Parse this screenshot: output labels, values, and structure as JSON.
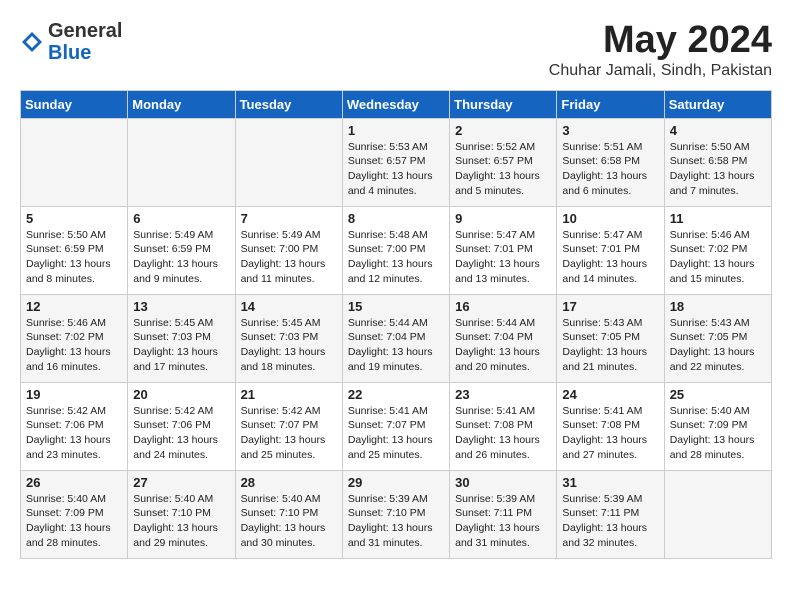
{
  "logo": {
    "general": "General",
    "blue": "Blue"
  },
  "title": {
    "month_year": "May 2024",
    "location": "Chuhar Jamali, Sindh, Pakistan"
  },
  "headers": [
    "Sunday",
    "Monday",
    "Tuesday",
    "Wednesday",
    "Thursday",
    "Friday",
    "Saturday"
  ],
  "weeks": [
    [
      {
        "day": "",
        "lines": []
      },
      {
        "day": "",
        "lines": []
      },
      {
        "day": "",
        "lines": []
      },
      {
        "day": "1",
        "lines": [
          "Sunrise: 5:53 AM",
          "Sunset: 6:57 PM",
          "Daylight: 13 hours",
          "and 4 minutes."
        ]
      },
      {
        "day": "2",
        "lines": [
          "Sunrise: 5:52 AM",
          "Sunset: 6:57 PM",
          "Daylight: 13 hours",
          "and 5 minutes."
        ]
      },
      {
        "day": "3",
        "lines": [
          "Sunrise: 5:51 AM",
          "Sunset: 6:58 PM",
          "Daylight: 13 hours",
          "and 6 minutes."
        ]
      },
      {
        "day": "4",
        "lines": [
          "Sunrise: 5:50 AM",
          "Sunset: 6:58 PM",
          "Daylight: 13 hours",
          "and 7 minutes."
        ]
      }
    ],
    [
      {
        "day": "5",
        "lines": [
          "Sunrise: 5:50 AM",
          "Sunset: 6:59 PM",
          "Daylight: 13 hours",
          "and 8 minutes."
        ]
      },
      {
        "day": "6",
        "lines": [
          "Sunrise: 5:49 AM",
          "Sunset: 6:59 PM",
          "Daylight: 13 hours",
          "and 9 minutes."
        ]
      },
      {
        "day": "7",
        "lines": [
          "Sunrise: 5:49 AM",
          "Sunset: 7:00 PM",
          "Daylight: 13 hours",
          "and 11 minutes."
        ]
      },
      {
        "day": "8",
        "lines": [
          "Sunrise: 5:48 AM",
          "Sunset: 7:00 PM",
          "Daylight: 13 hours",
          "and 12 minutes."
        ]
      },
      {
        "day": "9",
        "lines": [
          "Sunrise: 5:47 AM",
          "Sunset: 7:01 PM",
          "Daylight: 13 hours",
          "and 13 minutes."
        ]
      },
      {
        "day": "10",
        "lines": [
          "Sunrise: 5:47 AM",
          "Sunset: 7:01 PM",
          "Daylight: 13 hours",
          "and 14 minutes."
        ]
      },
      {
        "day": "11",
        "lines": [
          "Sunrise: 5:46 AM",
          "Sunset: 7:02 PM",
          "Daylight: 13 hours",
          "and 15 minutes."
        ]
      }
    ],
    [
      {
        "day": "12",
        "lines": [
          "Sunrise: 5:46 AM",
          "Sunset: 7:02 PM",
          "Daylight: 13 hours",
          "and 16 minutes."
        ]
      },
      {
        "day": "13",
        "lines": [
          "Sunrise: 5:45 AM",
          "Sunset: 7:03 PM",
          "Daylight: 13 hours",
          "and 17 minutes."
        ]
      },
      {
        "day": "14",
        "lines": [
          "Sunrise: 5:45 AM",
          "Sunset: 7:03 PM",
          "Daylight: 13 hours",
          "and 18 minutes."
        ]
      },
      {
        "day": "15",
        "lines": [
          "Sunrise: 5:44 AM",
          "Sunset: 7:04 PM",
          "Daylight: 13 hours",
          "and 19 minutes."
        ]
      },
      {
        "day": "16",
        "lines": [
          "Sunrise: 5:44 AM",
          "Sunset: 7:04 PM",
          "Daylight: 13 hours",
          "and 20 minutes."
        ]
      },
      {
        "day": "17",
        "lines": [
          "Sunrise: 5:43 AM",
          "Sunset: 7:05 PM",
          "Daylight: 13 hours",
          "and 21 minutes."
        ]
      },
      {
        "day": "18",
        "lines": [
          "Sunrise: 5:43 AM",
          "Sunset: 7:05 PM",
          "Daylight: 13 hours",
          "and 22 minutes."
        ]
      }
    ],
    [
      {
        "day": "19",
        "lines": [
          "Sunrise: 5:42 AM",
          "Sunset: 7:06 PM",
          "Daylight: 13 hours",
          "and 23 minutes."
        ]
      },
      {
        "day": "20",
        "lines": [
          "Sunrise: 5:42 AM",
          "Sunset: 7:06 PM",
          "Daylight: 13 hours",
          "and 24 minutes."
        ]
      },
      {
        "day": "21",
        "lines": [
          "Sunrise: 5:42 AM",
          "Sunset: 7:07 PM",
          "Daylight: 13 hours",
          "and 25 minutes."
        ]
      },
      {
        "day": "22",
        "lines": [
          "Sunrise: 5:41 AM",
          "Sunset: 7:07 PM",
          "Daylight: 13 hours",
          "and 25 minutes."
        ]
      },
      {
        "day": "23",
        "lines": [
          "Sunrise: 5:41 AM",
          "Sunset: 7:08 PM",
          "Daylight: 13 hours",
          "and 26 minutes."
        ]
      },
      {
        "day": "24",
        "lines": [
          "Sunrise: 5:41 AM",
          "Sunset: 7:08 PM",
          "Daylight: 13 hours",
          "and 27 minutes."
        ]
      },
      {
        "day": "25",
        "lines": [
          "Sunrise: 5:40 AM",
          "Sunset: 7:09 PM",
          "Daylight: 13 hours",
          "and 28 minutes."
        ]
      }
    ],
    [
      {
        "day": "26",
        "lines": [
          "Sunrise: 5:40 AM",
          "Sunset: 7:09 PM",
          "Daylight: 13 hours",
          "and 28 minutes."
        ]
      },
      {
        "day": "27",
        "lines": [
          "Sunrise: 5:40 AM",
          "Sunset: 7:10 PM",
          "Daylight: 13 hours",
          "and 29 minutes."
        ]
      },
      {
        "day": "28",
        "lines": [
          "Sunrise: 5:40 AM",
          "Sunset: 7:10 PM",
          "Daylight: 13 hours",
          "and 30 minutes."
        ]
      },
      {
        "day": "29",
        "lines": [
          "Sunrise: 5:39 AM",
          "Sunset: 7:10 PM",
          "Daylight: 13 hours",
          "and 31 minutes."
        ]
      },
      {
        "day": "30",
        "lines": [
          "Sunrise: 5:39 AM",
          "Sunset: 7:11 PM",
          "Daylight: 13 hours",
          "and 31 minutes."
        ]
      },
      {
        "day": "31",
        "lines": [
          "Sunrise: 5:39 AM",
          "Sunset: 7:11 PM",
          "Daylight: 13 hours",
          "and 32 minutes."
        ]
      },
      {
        "day": "",
        "lines": []
      }
    ]
  ]
}
